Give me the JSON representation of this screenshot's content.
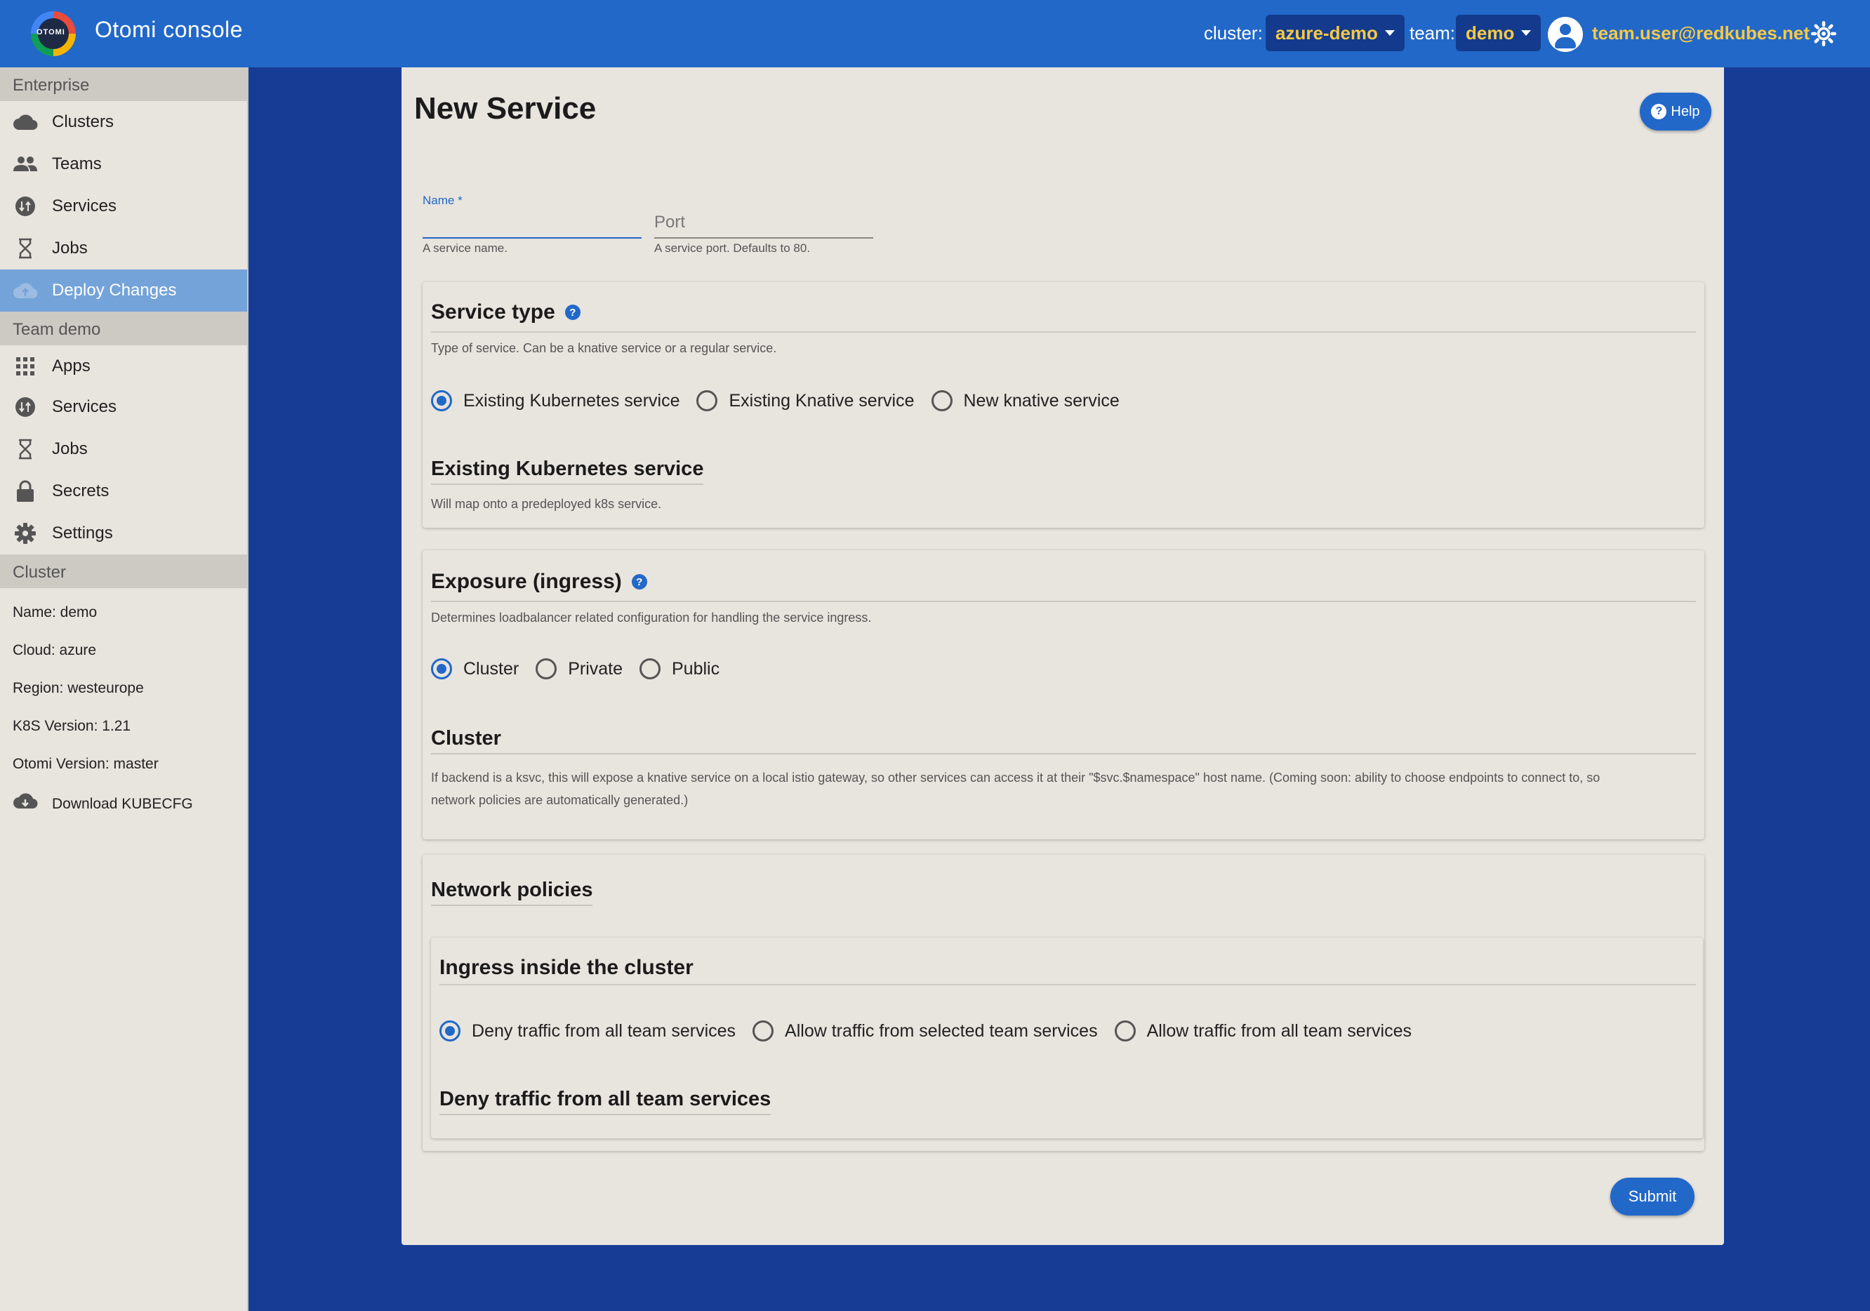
{
  "header": {
    "logo_text": "OTOMI",
    "title": "Otomi console",
    "cluster_label": "cluster:",
    "cluster_value": "azure-demo",
    "team_label": "team:",
    "team_value": "demo",
    "user_email": "team.user@redkubes.net"
  },
  "sidebar": {
    "enterprise_label": "Enterprise",
    "enterprise_items": [
      {
        "label": "Clusters",
        "icon": "cloud-icon"
      },
      {
        "label": "Teams",
        "icon": "people-icon"
      },
      {
        "label": "Services",
        "icon": "swap-icon"
      },
      {
        "label": "Jobs",
        "icon": "hourglass-icon"
      },
      {
        "label": "Deploy Changes",
        "icon": "cloud-upload-icon"
      }
    ],
    "team_label": "Team demo",
    "team_items": [
      {
        "label": "Apps",
        "icon": "apps-grid-icon"
      },
      {
        "label": "Services",
        "icon": "swap-icon"
      },
      {
        "label": "Jobs",
        "icon": "hourglass-icon"
      },
      {
        "label": "Secrets",
        "icon": "lock-icon"
      },
      {
        "label": "Settings",
        "icon": "gear-icon"
      }
    ],
    "cluster_label": "Cluster",
    "cluster_info": [
      "Name: demo",
      "Cloud: azure",
      "Region: westeurope",
      "K8S Version: 1.21",
      "Otomi Version: master"
    ],
    "download_label": "Download KUBECFG"
  },
  "main": {
    "title": "New Service",
    "help_label": "Help",
    "name_field": {
      "label": "Name *",
      "value": "",
      "hint": "A service name."
    },
    "port_field": {
      "placeholder": "Port",
      "hint": "A service port. Defaults to 80."
    },
    "service_type": {
      "title": "Service type",
      "description": "Type of service. Can be a knative service or a regular service.",
      "options": [
        "Existing Kubernetes service",
        "Existing Knative service",
        "New knative service"
      ],
      "selected": "Existing Kubernetes service",
      "sub_title": "Existing Kubernetes service",
      "sub_description": "Will map onto a predeployed k8s service."
    },
    "exposure": {
      "title": "Exposure (ingress)",
      "description": "Determines loadbalancer related configuration for handling the service ingress.",
      "options": [
        "Cluster",
        "Private",
        "Public"
      ],
      "selected": "Cluster",
      "sub_title": "Cluster",
      "sub_description_1": "If backend is a ksvc, this will expose a knative service on a local istio gateway, so other services can access it at their \"$svc.$namespace\" host name. (Coming soon: ability to choose endpoints to connect to, so",
      "sub_description_2": "network policies are automatically generated.)"
    },
    "network_policies": {
      "title": "Network policies",
      "ingress_title": "Ingress inside the cluster",
      "options": [
        "Deny traffic from all team services",
        "Allow traffic from selected team services",
        "Allow traffic from all team services"
      ],
      "selected": "Deny traffic from all team services",
      "sub_title": "Deny traffic from all team services"
    },
    "submit_label": "Submit"
  }
}
